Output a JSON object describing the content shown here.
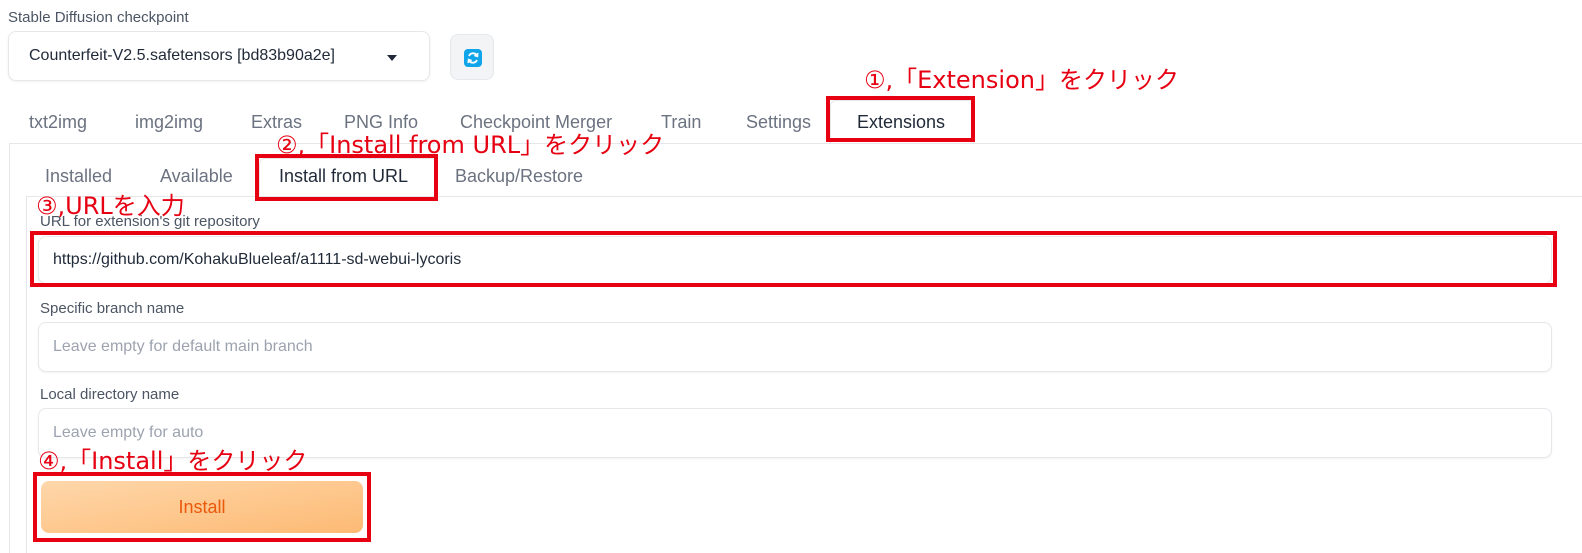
{
  "checkpoint": {
    "label": "Stable Diffusion checkpoint",
    "value": "Counterfeit-V2.5.safetensors [bd83b90a2e]",
    "refresh_icon": "refresh-icon"
  },
  "tabs": [
    {
      "label": "txt2img"
    },
    {
      "label": "img2img"
    },
    {
      "label": "Extras"
    },
    {
      "label": "PNG Info"
    },
    {
      "label": "Checkpoint Merger"
    },
    {
      "label": "Train"
    },
    {
      "label": "Settings"
    },
    {
      "label": "Extensions",
      "active": true
    }
  ],
  "subtabs": [
    {
      "label": "Installed"
    },
    {
      "label": "Available"
    },
    {
      "label": "Install from URL",
      "active": true
    },
    {
      "label": "Backup/Restore"
    }
  ],
  "form": {
    "url_label": "URL for extension's git repository",
    "url_value": "https://github.com/KohakuBlueleaf/a1111-sd-webui-lycoris",
    "branch_label": "Specific branch name",
    "branch_placeholder": "Leave empty for default main branch",
    "dir_label": "Local directory name",
    "dir_placeholder": "Leave empty for auto",
    "install_label": "Install"
  },
  "annotations": {
    "step1": "①,「Extension」をクリック",
    "step2": "②,「Install from URL」をクリック",
    "step3": "③,URLを入力",
    "step4": "④,「Install」をクリック"
  },
  "colors": {
    "annotation": "#e60012",
    "button_text": "#ea580c",
    "button_bg": "#fdba74"
  }
}
